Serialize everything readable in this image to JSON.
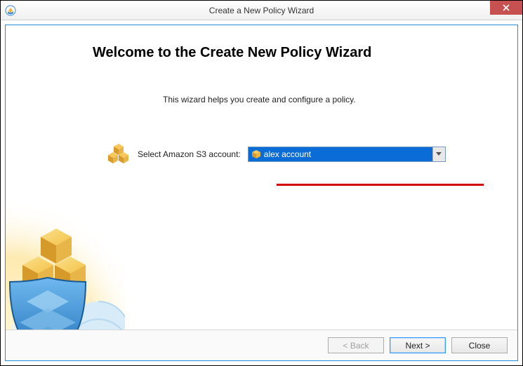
{
  "window": {
    "title": "Create a New Policy Wizard"
  },
  "page": {
    "heading": "Welcome to the Create New Policy Wizard",
    "description": "This wizard helps you create and configure a policy."
  },
  "form": {
    "account_label": "Select Amazon S3 account:",
    "account_selected": "alex account"
  },
  "buttons": {
    "back": "< Back",
    "next": "Next >",
    "close": "Close"
  },
  "icons": {
    "app": "cube-shield-icon",
    "close": "close-icon",
    "row": "cubes-icon",
    "dropdown_item": "cube-icon",
    "chevron": "chevron-down-icon"
  }
}
